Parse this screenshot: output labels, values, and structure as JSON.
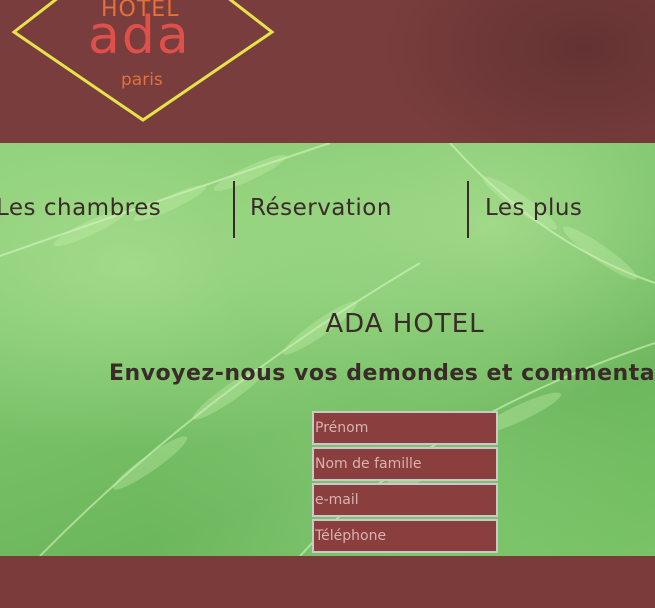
{
  "logo": {
    "hotel": "HOTEL",
    "name": "ada",
    "city": "paris",
    "frame_color": "#e6e34a",
    "text_color": "#e0504a"
  },
  "nav": {
    "items": [
      {
        "label": "Les chambres"
      },
      {
        "label": "Réservation"
      },
      {
        "label": "Les plus"
      }
    ]
  },
  "main": {
    "title": "ADA HOTEL",
    "subtitle": "Envoyez-nous vos demondes et commentaires"
  },
  "form": {
    "first_name_placeholder": "Prénom",
    "last_name_placeholder": "Nom de famille",
    "email_placeholder": "e-mail",
    "phone_placeholder": "Téléphone"
  },
  "colors": {
    "header_bg": "#793d3d",
    "field_bg": "#8a3e3e",
    "fern_green": "#7ac467"
  }
}
